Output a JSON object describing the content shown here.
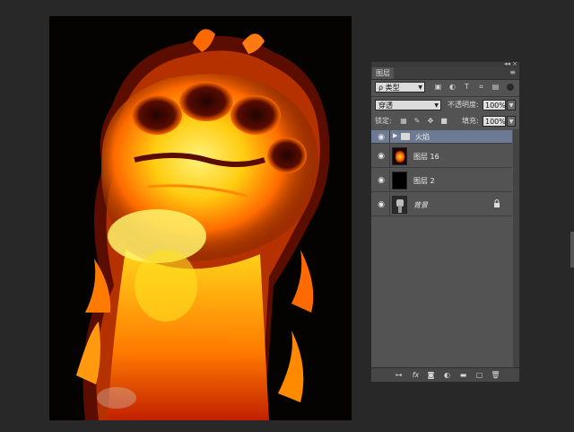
{
  "panel": {
    "tab_label": "图层",
    "collapse_glyph": "◂◂",
    "close_glyph": "×",
    "menu_glyph": "≡",
    "filter_kind": "ρ 类型",
    "blend_mode": "穿透",
    "opacity_label": "不透明度:",
    "opacity_value": "100%",
    "lock_label": "锁定:",
    "fill_label": "填充:",
    "fill_value": "100%",
    "layers": [
      {
        "name": "火焰",
        "type": "group"
      },
      {
        "name": "图层 16",
        "type": "layer"
      },
      {
        "name": "图层 2",
        "type": "layer"
      },
      {
        "name": "背景",
        "type": "background"
      }
    ],
    "lock_glyph": "🔒"
  },
  "icons": {
    "filter_icons": [
      "image-filter-icon",
      "adjustment-filter-icon",
      "type-filter-icon",
      "shape-filter-icon",
      "smart-object-filter-icon"
    ],
    "bottom_icons": [
      "link-icon",
      "fx-icon",
      "mask-icon",
      "adjustment-icon",
      "folder-icon",
      "new-layer-icon",
      "trash-icon"
    ]
  },
  "colors": {
    "panel_bg": "#535353",
    "selected_row": "#6c7b93",
    "app_bg": "#282828"
  }
}
